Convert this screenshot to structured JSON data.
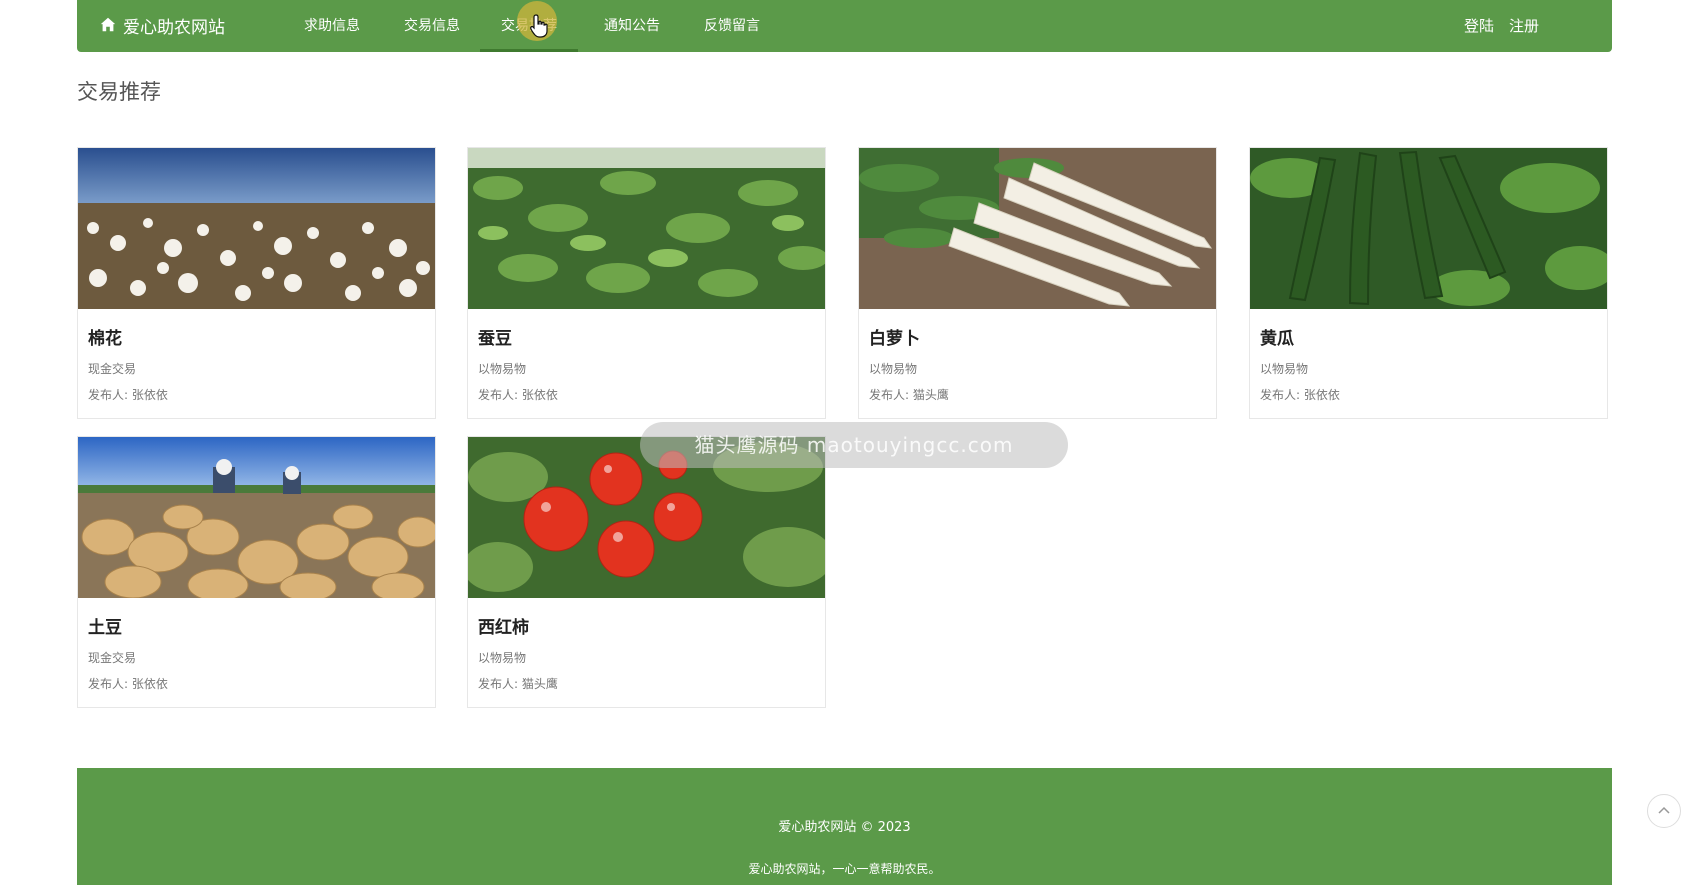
{
  "nav": {
    "brand": "爱心助农网站",
    "items": [
      "求助信息",
      "交易信息",
      "交易推荐",
      "通知公告",
      "反馈留言"
    ],
    "login": "登陆",
    "register": "注册"
  },
  "section_title": "交易推荐",
  "cards": [
    {
      "name": "棉花",
      "type": "现金交易",
      "publisher": "发布人: 张依依",
      "image": "cotton-field-photo"
    },
    {
      "name": "蚕豆",
      "type": "以物易物",
      "publisher": "发布人: 张依依",
      "image": "broad-bean-plants-photo"
    },
    {
      "name": "白萝卜",
      "type": "以物易物",
      "publisher": "发布人: 猫头鹰",
      "image": "white-radish-photo"
    },
    {
      "name": "黄瓜",
      "type": "以物易物",
      "publisher": "发布人: 张依依",
      "image": "cucumber-vine-photo"
    },
    {
      "name": "土豆",
      "type": "现金交易",
      "publisher": "发布人: 张依依",
      "image": "potato-harvest-photo"
    },
    {
      "name": "西红柿",
      "type": "以物易物",
      "publisher": "发布人: 猫头鹰",
      "image": "tomato-vine-photo"
    }
  ],
  "watermark": "猫头鹰源码 maotouyingcc.com",
  "footer": {
    "copyright": "爱心助农网站 © 2023",
    "slogan": "爱心助农网站，一心一意帮助农民。"
  },
  "colors": {
    "brand_green": "#5b9a49",
    "active_underline": "#3f7a2f"
  }
}
